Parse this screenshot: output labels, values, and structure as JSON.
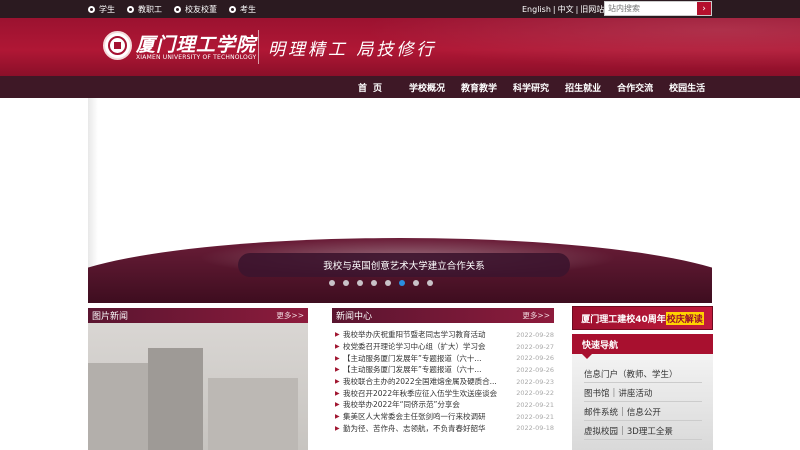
{
  "topbar": {
    "links": [
      "学生",
      "教职工",
      "校友校董",
      "考生"
    ],
    "lang": [
      "English",
      "中文",
      "旧网站"
    ],
    "search_placeholder": "站内搜索",
    "search_button": "›"
  },
  "header": {
    "school_name_cn": "厦门理工学院",
    "school_name_en": "XIAMEN UNIVERSITY OF TECHNOLOGY",
    "motto": "明理精工 局技修行"
  },
  "nav": {
    "items": [
      "首页",
      "学校概况",
      "教育教学",
      "科学研究",
      "招生就业",
      "合作交流",
      "校园生活"
    ]
  },
  "banner": {
    "caption": "我校与英国创意艺术大学建立合作关系",
    "slide_count": 8,
    "active_index": 5
  },
  "photo_news": {
    "title": "图片新闻",
    "more": "更多>>"
  },
  "news_center": {
    "title": "新闻中心",
    "more": "更多>>",
    "items": [
      {
        "title": "我校举办庆祝重阳节暨老同志学习教育活动",
        "date": "2022-09-28"
      },
      {
        "title": "校党委召开理论学习中心组（扩大）学习会",
        "date": "2022-09-27"
      },
      {
        "title": "【主动服务厦门发展年”专题报道（六十...",
        "date": "2022-09-26"
      },
      {
        "title": "【主动服务厦门发展年”专题报道（六十...",
        "date": "2022-09-26"
      },
      {
        "title": "我校联合主办的2022全国难熔金属及硬质合...",
        "date": "2022-09-23"
      },
      {
        "title": "我校召开2022年秋季应征入伍学生欢送座谈会",
        "date": "2022-09-22"
      },
      {
        "title": "我校举办2022年“同侪示范”分享会",
        "date": "2022-09-21"
      },
      {
        "title": "集美区人大常委会主任张剑鸣一行来校调研",
        "date": "2022-09-21"
      },
      {
        "title": "勤为径、苦作舟、志领航，不负青春好韶华",
        "date": "2022-09-18"
      }
    ]
  },
  "right": {
    "anniv_prefix": "厦门理工建校40周年",
    "anniv_highlight": "校庆解读",
    "quick_title": "快速导航",
    "quick_rows": [
      [
        "信息门户（教师、学生）"
      ],
      [
        "图书馆",
        "讲座活动"
      ],
      [
        "邮件系统",
        "信息公开"
      ],
      [
        "虚拟校园",
        "3D理工全景"
      ]
    ]
  }
}
